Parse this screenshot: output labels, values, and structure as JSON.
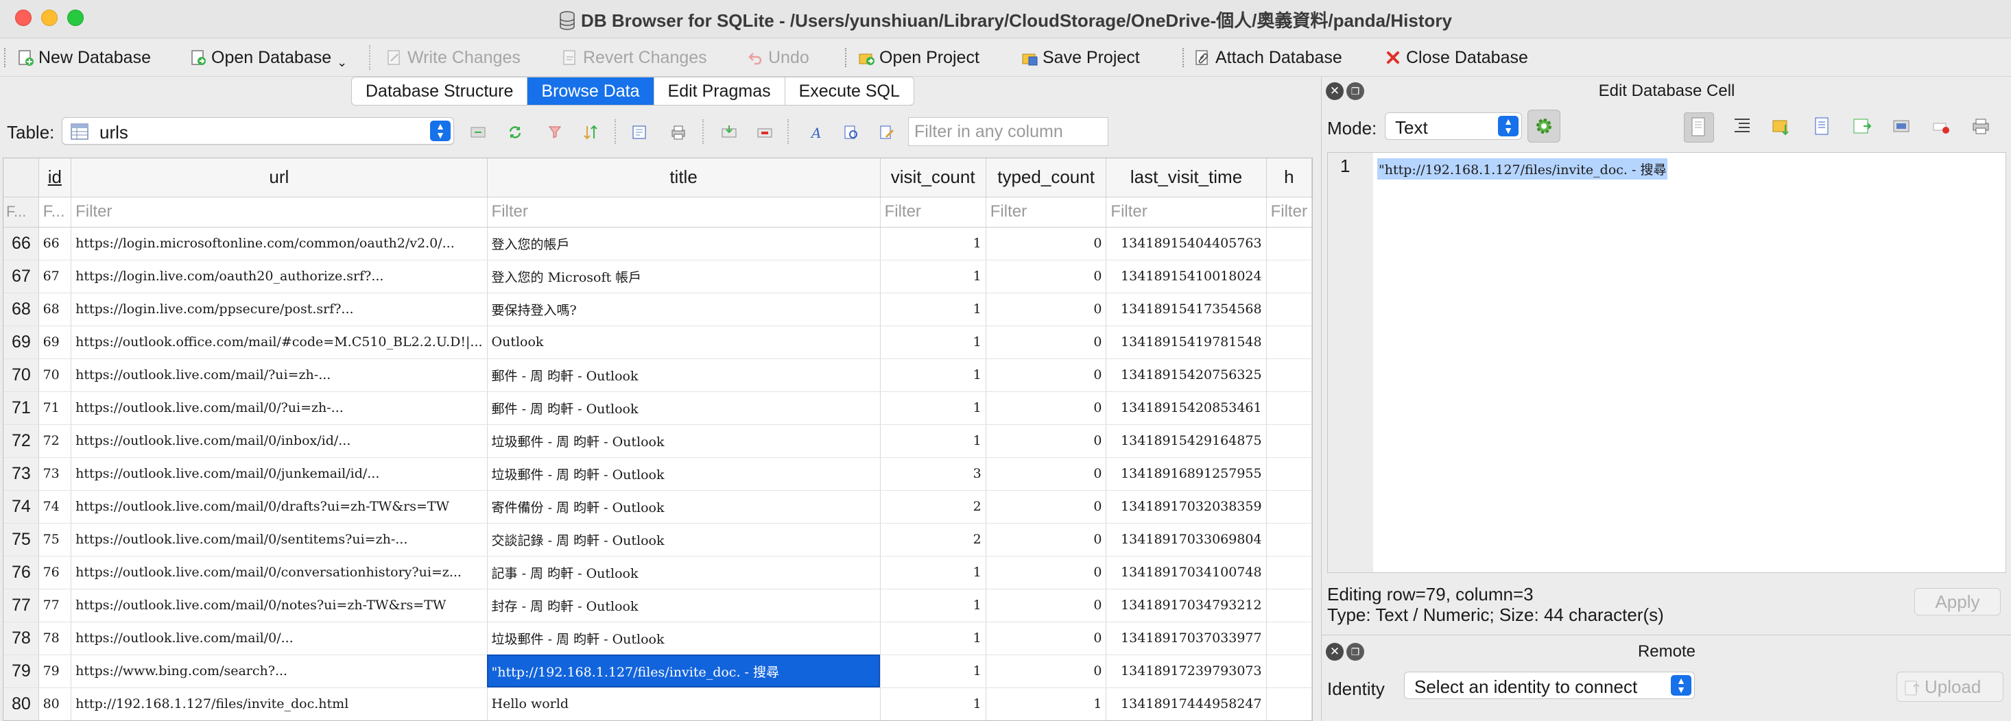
{
  "window": {
    "title": "DB Browser for SQLite - /Users/yunshiuan/Library/CloudStorage/OneDrive-個人/奧義資料/panda/History"
  },
  "toolbar": {
    "new_database": "New Database",
    "open_database": "Open Database",
    "write_changes": "Write Changes",
    "revert_changes": "Revert Changes",
    "undo": "Undo",
    "open_project": "Open Project",
    "save_project": "Save Project",
    "attach_database": "Attach Database",
    "close_database": "Close Database"
  },
  "tabs": [
    "Database Structure",
    "Browse Data",
    "Edit Pragmas",
    "Execute SQL"
  ],
  "active_tab": "Browse Data",
  "browse": {
    "table_label": "Table:",
    "table_value": "urls",
    "filter_all_placeholder": "Filter in any column"
  },
  "grid": {
    "columns": [
      "id",
      "url",
      "title",
      "visit_count",
      "typed_count",
      "last_visit_time",
      "h"
    ],
    "filter_placeholder": "Filter",
    "rownum_filter": "F...",
    "idfilter": "F...",
    "rows": [
      {
        "rownum": "66",
        "id": "66",
        "url": "https://login.microsoftonline.com/common/oauth2/v2.0/...",
        "title": "登入您的帳戶",
        "visit_count": "1",
        "typed_count": "0",
        "last_visit_time": "13418915404405763"
      },
      {
        "rownum": "67",
        "id": "67",
        "url": "https://login.live.com/oauth20_authorize.srf?...",
        "title": "登入您的 Microsoft 帳戶",
        "visit_count": "1",
        "typed_count": "0",
        "last_visit_time": "13418915410018024"
      },
      {
        "rownum": "68",
        "id": "68",
        "url": "https://login.live.com/ppsecure/post.srf?...",
        "title": "要保持登入嗎?",
        "visit_count": "1",
        "typed_count": "0",
        "last_visit_time": "13418915417354568"
      },
      {
        "rownum": "69",
        "id": "69",
        "url": "https://outlook.office.com/mail/#code=M.C510_BL2.2.U.D!|...",
        "title": "Outlook",
        "visit_count": "1",
        "typed_count": "0",
        "last_visit_time": "13418915419781548"
      },
      {
        "rownum": "70",
        "id": "70",
        "url": "https://outlook.live.com/mail/?ui=zh-...",
        "title": "郵件 - 周 昀軒 - Outlook",
        "visit_count": "1",
        "typed_count": "0",
        "last_visit_time": "13418915420756325"
      },
      {
        "rownum": "71",
        "id": "71",
        "url": "https://outlook.live.com/mail/0/?ui=zh-...",
        "title": "郵件 - 周 昀軒 - Outlook",
        "visit_count": "1",
        "typed_count": "0",
        "last_visit_time": "13418915420853461"
      },
      {
        "rownum": "72",
        "id": "72",
        "url": "https://outlook.live.com/mail/0/inbox/id/...",
        "title": "垃圾郵件 - 周 昀軒 - Outlook",
        "visit_count": "1",
        "typed_count": "0",
        "last_visit_time": "13418915429164875"
      },
      {
        "rownum": "73",
        "id": "73",
        "url": "https://outlook.live.com/mail/0/junkemail/id/...",
        "title": "垃圾郵件 - 周 昀軒 - Outlook",
        "visit_count": "3",
        "typed_count": "0",
        "last_visit_time": "13418916891257955"
      },
      {
        "rownum": "74",
        "id": "74",
        "url": "https://outlook.live.com/mail/0/drafts?ui=zh-TW&rs=TW",
        "title": "寄件備份 - 周 昀軒 - Outlook",
        "visit_count": "2",
        "typed_count": "0",
        "last_visit_time": "13418917032038359"
      },
      {
        "rownum": "75",
        "id": "75",
        "url": "https://outlook.live.com/mail/0/sentitems?ui=zh-...",
        "title": "交談記錄 - 周 昀軒 - Outlook",
        "visit_count": "2",
        "typed_count": "0",
        "last_visit_time": "13418917033069804"
      },
      {
        "rownum": "76",
        "id": "76",
        "url": "https://outlook.live.com/mail/0/conversationhistory?ui=z...",
        "title": "記事 - 周 昀軒 - Outlook",
        "visit_count": "1",
        "typed_count": "0",
        "last_visit_time": "13418917034100748"
      },
      {
        "rownum": "77",
        "id": "77",
        "url": "https://outlook.live.com/mail/0/notes?ui=zh-TW&rs=TW",
        "title": "封存 - 周 昀軒 - Outlook",
        "visit_count": "1",
        "typed_count": "0",
        "last_visit_time": "13418917034793212"
      },
      {
        "rownum": "78",
        "id": "78",
        "url": "https://outlook.live.com/mail/0/...",
        "title": "垃圾郵件 - 周 昀軒 - Outlook",
        "visit_count": "1",
        "typed_count": "0",
        "last_visit_time": "13418917037033977"
      },
      {
        "rownum": "79",
        "id": "79",
        "url": "https://www.bing.com/search?...",
        "title": "\"http://192.168.1.127/files/invite_doc. - 搜尋",
        "visit_count": "1",
        "typed_count": "0",
        "last_visit_time": "13418917239793073",
        "selected": true
      },
      {
        "rownum": "80",
        "id": "80",
        "url": "http://192.168.1.127/files/invite_doc.html",
        "title": "Hello world",
        "visit_count": "1",
        "typed_count": "1",
        "last_visit_time": "13418917444958247"
      }
    ]
  },
  "edit_cell": {
    "header": "Edit Database Cell",
    "mode_label": "Mode:",
    "mode_value": "Text",
    "line_number": "1",
    "content": "\"http://192.168.1.127/files/invite_doc. - 搜尋",
    "status_row": "Editing row=79, column=3",
    "status_type": "Type: Text / Numeric; Size: 44 character(s)",
    "apply": "Apply"
  },
  "remote": {
    "header": "Remote",
    "identity_label": "Identity",
    "identity_value": "Select an identity to connect",
    "upload": "Upload"
  },
  "colors": {
    "accent": "#1671ea",
    "selection": "#1264dc",
    "text_selection": "#b5d4fe"
  }
}
